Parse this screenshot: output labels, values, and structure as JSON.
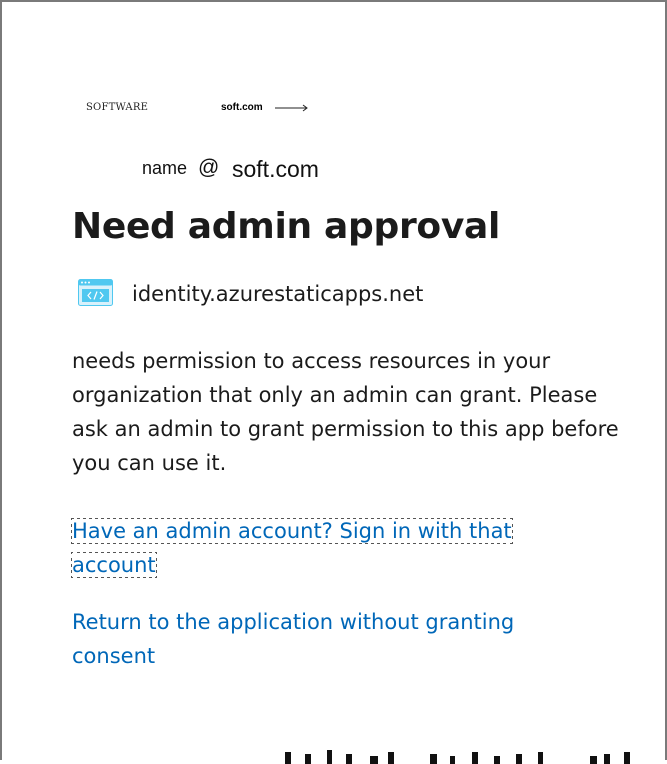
{
  "header": {
    "brand_text": "SOFTWARE",
    "domain_text": "soft.com",
    "arrow_icon": "long-arrow-right-icon"
  },
  "account": {
    "name": "name",
    "at": "@",
    "domain": "soft.com"
  },
  "page": {
    "title": "Need admin approval"
  },
  "app": {
    "icon": "web-app-code-icon",
    "url": "identity.azurestaticapps.net",
    "icon_color": "#50c8f0"
  },
  "description": "needs permission to access resources in your organization that only an admin can grant. Please ask an admin to grant permission to this app before you can use it.",
  "links": {
    "signin_label": "Have an admin account? Sign in with that account",
    "return_label": "Return to the application without granting consent"
  },
  "colors": {
    "link": "#0067b8",
    "text": "#1b1b1b",
    "border": "#7a7a7a"
  }
}
